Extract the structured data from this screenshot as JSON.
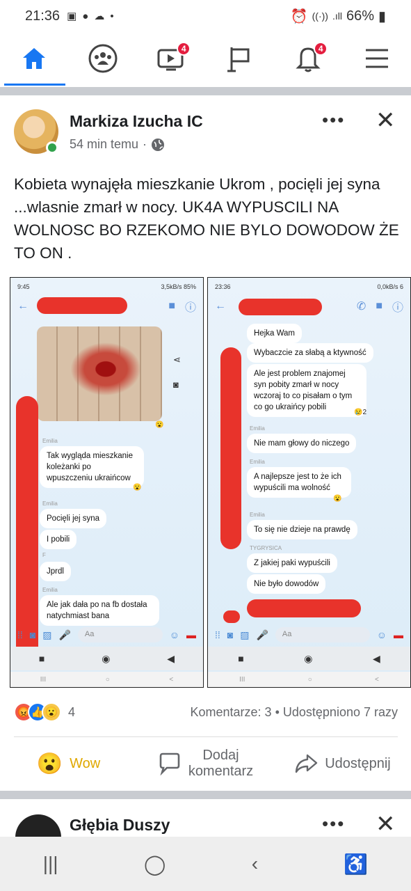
{
  "status_bar": {
    "time": "21:36",
    "battery": "66%"
  },
  "nav": {
    "items": [
      {
        "name": "home",
        "badge": ""
      },
      {
        "name": "groups",
        "badge": ""
      },
      {
        "name": "watch",
        "badge": "4"
      },
      {
        "name": "pages",
        "badge": ""
      },
      {
        "name": "notifications",
        "badge": "4"
      },
      {
        "name": "menu",
        "badge": ""
      }
    ]
  },
  "post": {
    "author": "Markiza Izucha IC",
    "time": "54 min temu",
    "text": "Kobieta wynajęła  mieszkanie Ukrom , pocięli jej syna ...wlasnie zmarł w nocy. UK4A WYPUSCILI NA WOLNOSC BO RZEKOMO NIE BYLO DOWODOW ŻE TO ON .",
    "reaction_count": "4",
    "comments": "Komentarze: 3",
    "shares": "Udostępniono 7 razy",
    "actions": {
      "wow": "Wow",
      "comment_line1": "Dodaj",
      "comment_line2": "komentarz",
      "share": "Udostępnij"
    }
  },
  "screenshot_left": {
    "status_time": "9:45",
    "status_right": "3,5kB/s  85%",
    "sender1": "Emilia",
    "msg1": "Tak wygląda mieszkanie koleżanki po wpuszczeniu ukraińcow",
    "sender2": "Emilia",
    "msg2": "Pocięli jej syna",
    "msg3": "I pobili",
    "sender3": "Emilia",
    "msg4": "Jprdl",
    "sender4": "Emilia",
    "msg5": "Ale jak dała po    na fb dostała natychmiast bana",
    "composer": "Aa"
  },
  "screenshot_right": {
    "status_time": "23:36",
    "status_right": "0,0kB/s  6",
    "msg1": "Hejka Wam",
    "msg2": "Wybaczcie za słabą a ktywność",
    "msg3": "Ale jest problem znajomej syn pobity zmarł w nocy wczoraj to co pisałam o tym co go ukraińcy pobili",
    "msg3_react": "2",
    "sender1": "Emilia",
    "msg4": "Nie mam głowy do niczego",
    "sender2": "Emilia",
    "msg5": "A najlepsze jest to że ich wypuścili ma wolność",
    "sender3": "Emilia",
    "msg6": "To się nie dzieje na prawdę",
    "sender4": "TYGRYSICA",
    "msg7": "Z jakiej  paki wypuścili",
    "msg8": "Nie było dowodów",
    "composer": "Aa"
  },
  "next_post": {
    "author": "Głębia Duszy"
  },
  "colors": {
    "accent": "#1877f2",
    "badge": "#e41e3f",
    "redaction": "#e8332b",
    "wow": "#e0a800"
  }
}
